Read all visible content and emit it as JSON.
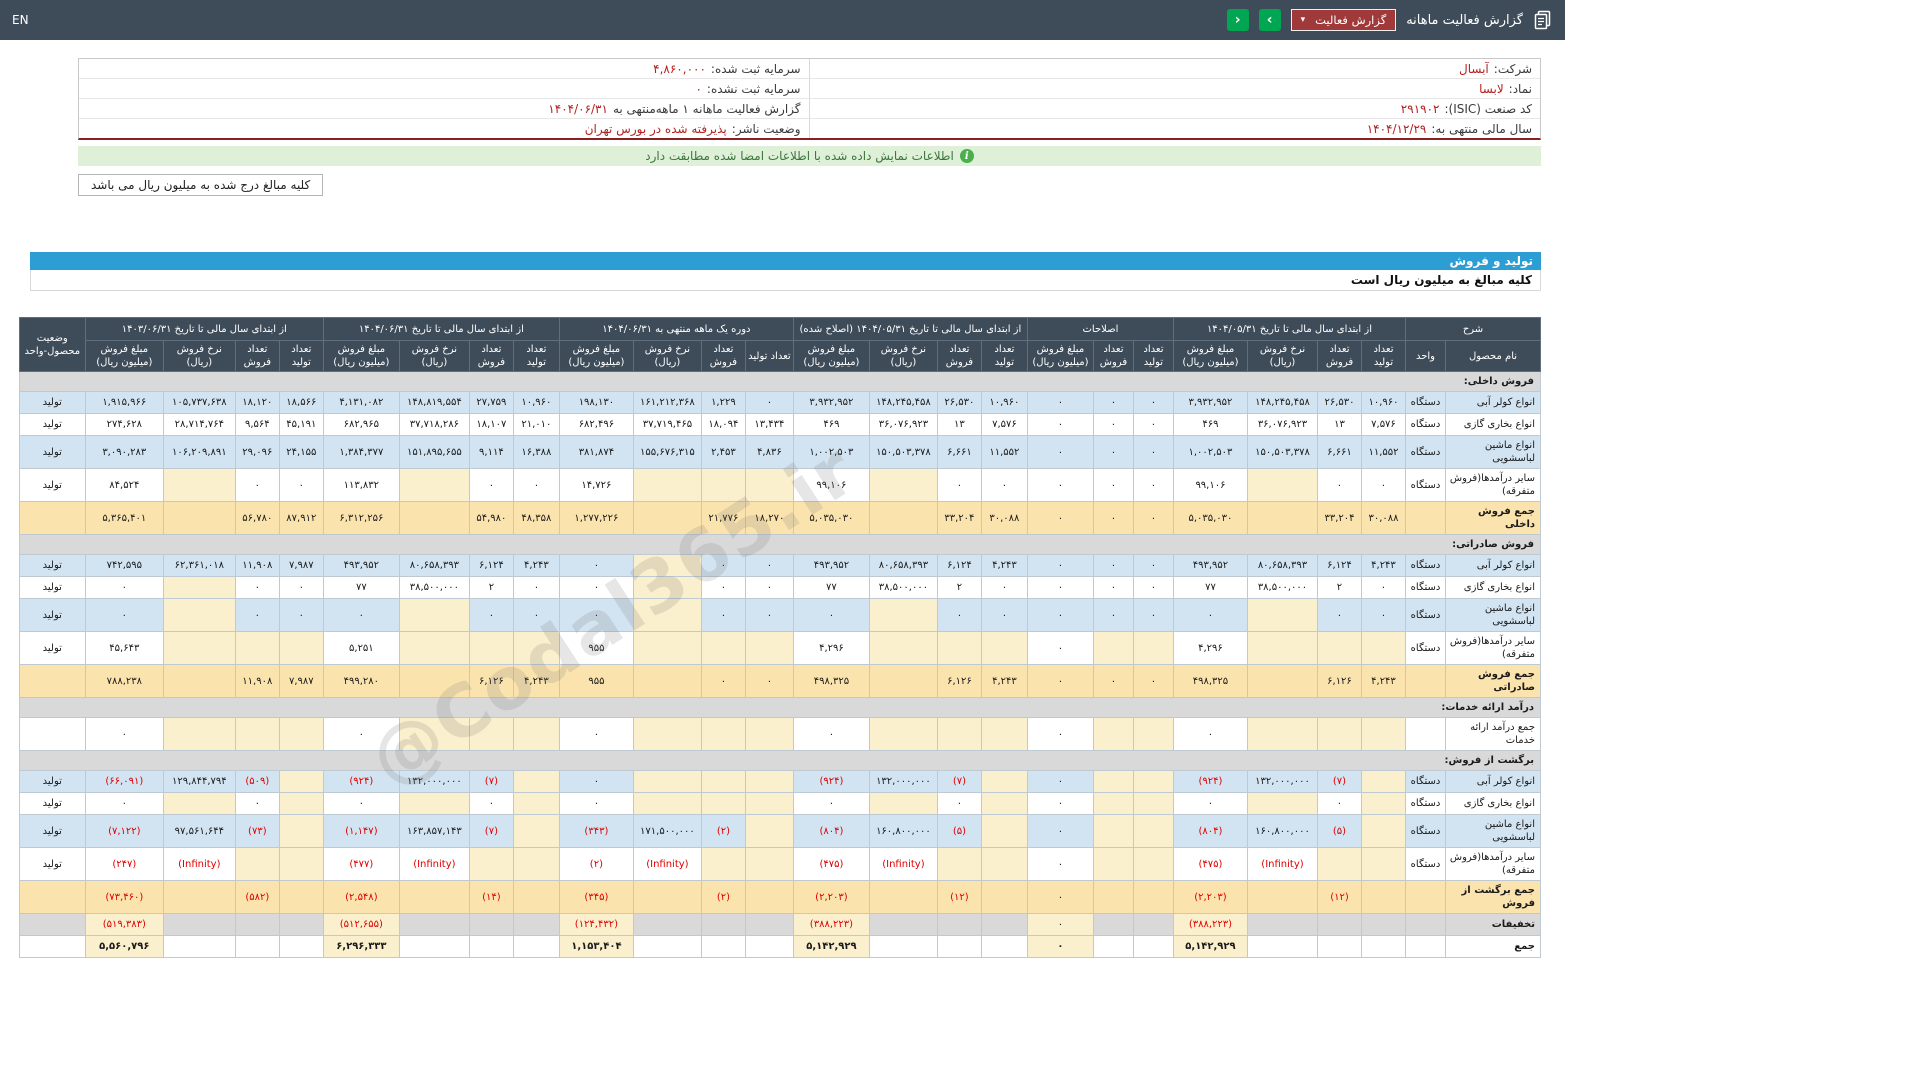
{
  "topbar": {
    "title": "گزارش فعالیت ماهانه",
    "report_select_label": "گزارش فعالیت",
    "chevron": "▾",
    "nav_next": "›",
    "nav_prev": "‹",
    "lang": "EN"
  },
  "info": {
    "right": [
      {
        "label": "شرکت:",
        "value": "آبسال"
      },
      {
        "label": "نماد:",
        "value": "لابسا"
      },
      {
        "label": "کد صنعت (ISIC):",
        "value": "۲۹۱۹۰۲"
      },
      {
        "label": "سال مالی منتهی به:",
        "value": "۱۴۰۴/۱۲/۲۹"
      }
    ],
    "left": [
      {
        "label": "سرمایه ثبت شده:",
        "value": "۴,۸۶۰,۰۰۰"
      },
      {
        "label": "سرمایه ثبت نشده:",
        "value": "۰"
      },
      {
        "label": "گزارش فعالیت ماهانه ۱ ماهه‌منتهی به",
        "value": "۱۴۰۴/۰۶/۳۱"
      },
      {
        "label": "وضعیت ناشر:",
        "value": "پذیرفته شده در بورس تهران"
      }
    ]
  },
  "notice": "اطلاعات نمایش داده شده با اطلاعات امضا شده مطابقت دارد",
  "amounts_note": "کلیه مبالغ درج شده به میلیون ریال می باشد",
  "section": {
    "title": "تولید و فروش",
    "subtitle": "کلیه مبالغ به میلیون ریال است"
  },
  "watermark": "@Codal365.ir",
  "colors": {
    "topbar": "#3e4c5a",
    "accent_blue": "#2d9ed3",
    "notice_green_bg": "#dff0d8",
    "notice_green_text": "#3c763d",
    "value_red": "#b22222",
    "negative_red": "#e00000",
    "sum_row": "#fbe3ad",
    "stripe_blue": "#d2e4f2",
    "cream_cell": "#fbf0cd",
    "section_gray": "#d9d9d9",
    "nav_green": "#00a651",
    "dropdown_red": "#a03a3a"
  },
  "table": {
    "desc_header": "شرح",
    "name_col": "نام محصول",
    "unit_col": "واحد",
    "status_col": "وضعیت محصول-واحد",
    "groups": [
      {
        "title": "از ابتدای سال مالی تا تاریخ ۱۴۰۴/۰۵/۳۱",
        "cols": [
          "تعداد تولید",
          "تعداد فروش",
          "نرخ فروش (ریال)",
          "مبلغ فروش (میلیون ریال)"
        ]
      },
      {
        "title": "اصلاحات",
        "cols": [
          "تعداد تولید",
          "تعداد فروش",
          "مبلغ فروش (میلیون ریال)"
        ]
      },
      {
        "title": "از ابتدای سال مالی تا تاریخ ۱۴۰۴/۰۵/۳۱ (اصلاح شده)",
        "cols": [
          "تعداد تولید",
          "تعداد فروش",
          "نرخ فروش (ریال)",
          "مبلغ فروش (میلیون ریال)"
        ]
      },
      {
        "title": "دوره یک ماهه منتهی به ۱۴۰۴/۰۶/۳۱",
        "cols": [
          "تعداد تولید",
          "تعداد فروش",
          "نرخ فروش (ریال)",
          "مبلغ فروش (میلیون ریال)"
        ]
      },
      {
        "title": "از ابتدای سال مالی تا تاریخ ۱۴۰۴/۰۶/۳۱",
        "cols": [
          "تعداد تولید",
          "تعداد فروش",
          "نرخ فروش (ریال)",
          "مبلغ فروش (میلیون ریال)"
        ]
      },
      {
        "title": "از ابتدای سال مالی تا تاریخ ۱۴۰۳/۰۶/۳۱",
        "cols": [
          "تعداد تولید",
          "تعداد فروش",
          "نرخ فروش (ریال)",
          "مبلغ فروش (میلیون ریال)"
        ]
      }
    ],
    "rows": [
      {
        "type": "section",
        "label": "فروش داخلی:"
      },
      {
        "type": "data",
        "stripe": "blue",
        "name": "انواع کولر آبی",
        "unit": "دستگاه",
        "status": "تولید",
        "cells": [
          "۱۰,۹۶۰",
          "۲۶,۵۳۰",
          "۱۴۸,۲۴۵,۴۵۸",
          "۳,۹۳۲,۹۵۲",
          "۰",
          "۰",
          "۰",
          "۱۰,۹۶۰",
          "۲۶,۵۳۰",
          "۱۴۸,۲۴۵,۴۵۸",
          "۳,۹۳۲,۹۵۲",
          "۰",
          "۱,۲۲۹",
          "۱۶۱,۲۱۲,۳۶۸",
          "۱۹۸,۱۳۰",
          "۱۰,۹۶۰",
          "۲۷,۷۵۹",
          "۱۴۸,۸۱۹,۵۵۴",
          "۴,۱۳۱,۰۸۲",
          "۱۸,۵۶۶",
          "۱۸,۱۲۰",
          "۱۰۵,۷۳۷,۶۳۸",
          "۱,۹۱۵,۹۶۶"
        ]
      },
      {
        "type": "data",
        "stripe": "white",
        "name": "انواع بخاری گازی",
        "unit": "دستگاه",
        "status": "تولید",
        "cells": [
          "۷,۵۷۶",
          "۱۳",
          "۳۶,۰۷۶,۹۲۳",
          "۴۶۹",
          "۰",
          "۰",
          "۰",
          "۷,۵۷۶",
          "۱۳",
          "۳۶,۰۷۶,۹۲۳",
          "۴۶۹",
          "۱۳,۴۳۴",
          "۱۸,۰۹۴",
          "۳۷,۷۱۹,۴۶۵",
          "۶۸۲,۴۹۶",
          "۲۱,۰۱۰",
          "۱۸,۱۰۷",
          "۳۷,۷۱۸,۲۸۶",
          "۶۸۲,۹۶۵",
          "۴۵,۱۹۱",
          "۹,۵۶۴",
          "۲۸,۷۱۴,۷۶۴",
          "۲۷۴,۶۲۸"
        ]
      },
      {
        "type": "data",
        "stripe": "blue",
        "name": "انواع ماشین لباسشویی",
        "unit": "دستگاه",
        "status": "تولید",
        "cells": [
          "۱۱,۵۵۲",
          "۶,۶۶۱",
          "۱۵۰,۵۰۳,۳۷۸",
          "۱,۰۰۲,۵۰۳",
          "۰",
          "۰",
          "۰",
          "۱۱,۵۵۲",
          "۶,۶۶۱",
          "۱۵۰,۵۰۳,۳۷۸",
          "۱,۰۰۲,۵۰۳",
          "۴,۸۳۶",
          "۲,۴۵۳",
          "۱۵۵,۶۷۶,۳۱۵",
          "۳۸۱,۸۷۴",
          "۱۶,۳۸۸",
          "۹,۱۱۴",
          "۱۵۱,۸۹۵,۶۵۵",
          "۱,۳۸۴,۳۷۷",
          "۲۴,۱۵۵",
          "۲۹,۰۹۶",
          "۱۰۶,۲۰۹,۸۹۱",
          "۳,۰۹۰,۲۸۳"
        ]
      },
      {
        "type": "data",
        "stripe": "white",
        "name": "سایر درآمدها(فروش متفرقه)",
        "unit": "دستگاه",
        "status": "تولید",
        "cells": [
          "۰",
          "۰",
          "",
          "۹۹,۱۰۶",
          "۰",
          "۰",
          "۰",
          "۰",
          "۰",
          "",
          "۹۹,۱۰۶",
          "",
          "",
          "",
          "۱۴,۷۲۶",
          "۰",
          "۰",
          "",
          "۱۱۳,۸۳۲",
          "۰",
          "۰",
          "",
          "۸۴,۵۲۴"
        ]
      },
      {
        "type": "sum",
        "name": "جمع فروش داخلی",
        "unit": "",
        "status": "",
        "cells": [
          "۳۰,۰۸۸",
          "۳۳,۲۰۴",
          "",
          "۵,۰۳۵,۰۳۰",
          "۰",
          "۰",
          "۰",
          "۳۰,۰۸۸",
          "۳۳,۲۰۴",
          "",
          "۵,۰۳۵,۰۳۰",
          "۱۸,۲۷۰",
          "۲۱,۷۷۶",
          "",
          "۱,۲۷۷,۲۲۶",
          "۴۸,۳۵۸",
          "۵۴,۹۸۰",
          "",
          "۶,۳۱۲,۲۵۶",
          "۸۷,۹۱۲",
          "۵۶,۷۸۰",
          "",
          "۵,۳۶۵,۴۰۱"
        ]
      },
      {
        "type": "section",
        "label": "فروش صادراتی:"
      },
      {
        "type": "data",
        "stripe": "blue",
        "name": "انواع کولر آبی",
        "unit": "دستگاه",
        "status": "تولید",
        "cells": [
          "۴,۲۴۳",
          "۶,۱۲۴",
          "۸۰,۶۵۸,۳۹۳",
          "۴۹۳,۹۵۲",
          "۰",
          "۰",
          "۰",
          "۴,۲۴۳",
          "۶,۱۲۴",
          "۸۰,۶۵۸,۳۹۳",
          "۴۹۳,۹۵۲",
          "۰",
          "۰",
          "",
          "۰",
          "۴,۲۴۳",
          "۶,۱۲۴",
          "۸۰,۶۵۸,۳۹۳",
          "۴۹۳,۹۵۲",
          "۷,۹۸۷",
          "۱۱,۹۰۸",
          "۶۲,۳۶۱,۰۱۸",
          "۷۴۲,۵۹۵"
        ]
      },
      {
        "type": "data",
        "stripe": "white",
        "name": "انواع بخاری گازی",
        "unit": "دستگاه",
        "status": "تولید",
        "cells": [
          "۰",
          "۲",
          "۳۸,۵۰۰,۰۰۰",
          "۷۷",
          "۰",
          "۰",
          "۰",
          "۰",
          "۲",
          "۳۸,۵۰۰,۰۰۰",
          "۷۷",
          "۰",
          "۰",
          "",
          "۰",
          "۰",
          "۲",
          "۳۸,۵۰۰,۰۰۰",
          "۷۷",
          "۰",
          "۰",
          "",
          "۰"
        ]
      },
      {
        "type": "data",
        "stripe": "blue",
        "name": "انواع ماشین لباسشویی",
        "unit": "دستگاه",
        "status": "تولید",
        "cells": [
          "۰",
          "۰",
          "",
          "۰",
          "۰",
          "۰",
          "۰",
          "۰",
          "۰",
          "",
          "۰",
          "۰",
          "۰",
          "",
          "۰",
          "۰",
          "۰",
          "",
          "۰",
          "۰",
          "۰",
          "",
          "۰"
        ]
      },
      {
        "type": "data",
        "stripe": "white",
        "name": "سایر درآمدها(فروش متفرقه)",
        "unit": "دستگاه",
        "status": "تولید",
        "cells": [
          "",
          "",
          "",
          "۴,۲۹۶",
          "",
          "",
          "۰",
          "",
          "",
          "",
          "۴,۲۹۶",
          "",
          "",
          "",
          "۹۵۵",
          "",
          "",
          "",
          "۵,۲۵۱",
          "",
          "",
          "",
          "۴۵,۶۴۳"
        ]
      },
      {
        "type": "sum",
        "name": "جمع فروش صادراتی",
        "unit": "",
        "status": "",
        "cells": [
          "۴,۲۴۳",
          "۶,۱۲۶",
          "",
          "۴۹۸,۳۲۵",
          "۰",
          "۰",
          "۰",
          "۴,۲۴۳",
          "۶,۱۲۶",
          "",
          "۴۹۸,۳۲۵",
          "۰",
          "۰",
          "",
          "۹۵۵",
          "۴,۲۴۳",
          "۶,۱۲۶",
          "",
          "۴۹۹,۲۸۰",
          "۷,۹۸۷",
          "۱۱,۹۰۸",
          "",
          "۷۸۸,۲۳۸"
        ]
      },
      {
        "type": "section",
        "label": "درآمد ارائه خدمات:"
      },
      {
        "type": "data",
        "stripe": "white",
        "name": "جمع درآمد ارائه خدمات",
        "unit": "",
        "status": "",
        "cells": [
          "",
          "",
          "",
          "۰",
          "",
          "",
          "۰",
          "",
          "",
          "",
          "۰",
          "",
          "",
          "",
          "۰",
          "",
          "",
          "",
          "۰",
          "",
          "",
          "",
          "۰"
        ]
      },
      {
        "type": "section",
        "label": "برگشت از فروش:"
      },
      {
        "type": "data",
        "stripe": "blue",
        "name": "انواع کولر آبی",
        "unit": "دستگاه",
        "status": "تولید",
        "cells": [
          "",
          "(۷)",
          "۱۳۲,۰۰۰,۰۰۰",
          "(۹۲۴)",
          "",
          "",
          "۰",
          "",
          "(۷)",
          "۱۳۲,۰۰۰,۰۰۰",
          "(۹۲۴)",
          "",
          "",
          "",
          "۰",
          "",
          "(۷)",
          "۱۳۲,۰۰۰,۰۰۰",
          "(۹۲۴)",
          "",
          "(۵۰۹)",
          "۱۲۹,۸۴۴,۷۹۴",
          "(۶۶,۰۹۱)"
        ]
      },
      {
        "type": "data",
        "stripe": "white",
        "name": "انواع بخاری گازی",
        "unit": "دستگاه",
        "status": "تولید",
        "cells": [
          "",
          "۰",
          "",
          "۰",
          "",
          "",
          "۰",
          "",
          "۰",
          "",
          "۰",
          "",
          "",
          "",
          "۰",
          "",
          "۰",
          "",
          "۰",
          "",
          "۰",
          "",
          "۰"
        ]
      },
      {
        "type": "data",
        "stripe": "blue",
        "name": "انواع ماشین لباسشویی",
        "unit": "دستگاه",
        "status": "تولید",
        "cells": [
          "",
          "(۵)",
          "۱۶۰,۸۰۰,۰۰۰",
          "(۸۰۴)",
          "",
          "",
          "۰",
          "",
          "(۵)",
          "۱۶۰,۸۰۰,۰۰۰",
          "(۸۰۴)",
          "",
          "(۲)",
          "۱۷۱,۵۰۰,۰۰۰",
          "(۳۴۳)",
          "",
          "(۷)",
          "۱۶۳,۸۵۷,۱۴۳",
          "(۱,۱۴۷)",
          "",
          "(۷۳)",
          "۹۷,۵۶۱,۶۴۴",
          "(۷,۱۲۲)"
        ]
      },
      {
        "type": "data",
        "stripe": "white",
        "name": "سایر درآمدها(فروش متفرقه)",
        "unit": "دستگاه",
        "status": "تولید",
        "cells": [
          "",
          "",
          "(Infinity)",
          "(۴۷۵)",
          "",
          "",
          "۰",
          "",
          "",
          "(Infinity)",
          "(۴۷۵)",
          "",
          "",
          "(Infinity)",
          "(۲)",
          "",
          "",
          "(Infinity)",
          "(۴۷۷)",
          "",
          "",
          "(Infinity)",
          "(۲۴۷)"
        ]
      },
      {
        "type": "sum",
        "name": "جمع برگشت از فروش",
        "unit": "",
        "status": "",
        "cells": [
          "",
          "(۱۲)",
          "",
          "(۲,۲۰۳)",
          "",
          "",
          "۰",
          "",
          "(۱۲)",
          "",
          "(۲,۲۰۳)",
          "",
          "(۲)",
          "",
          "(۳۴۵)",
          "",
          "(۱۴)",
          "",
          "(۲,۵۴۸)",
          "",
          "(۵۸۲)",
          "",
          "(۷۳,۴۶۰)"
        ]
      },
      {
        "type": "misc",
        "name": "تخفیفات",
        "unit": "",
        "status": "",
        "cells": [
          "",
          "",
          "",
          "(۳۸۸,۲۲۳)",
          "",
          "",
          "۰",
          "",
          "",
          "",
          "(۳۸۸,۲۲۳)",
          "",
          "",
          "",
          "(۱۲۴,۴۳۲)",
          "",
          "",
          "",
          "(۵۱۲,۶۵۵)",
          "",
          "",
          "",
          "(۵۱۹,۳۸۳)"
        ]
      },
      {
        "type": "grand",
        "name": "جمع",
        "unit": "",
        "status": "",
        "cells": [
          "",
          "",
          "",
          "۵,۱۴۲,۹۲۹",
          "",
          "",
          "۰",
          "",
          "",
          "",
          "۵,۱۴۲,۹۲۹",
          "",
          "",
          "",
          "۱,۱۵۳,۴۰۴",
          "",
          "",
          "",
          "۶,۲۹۶,۳۳۳",
          "",
          "",
          "",
          "۵,۵۶۰,۷۹۶"
        ]
      }
    ]
  }
}
